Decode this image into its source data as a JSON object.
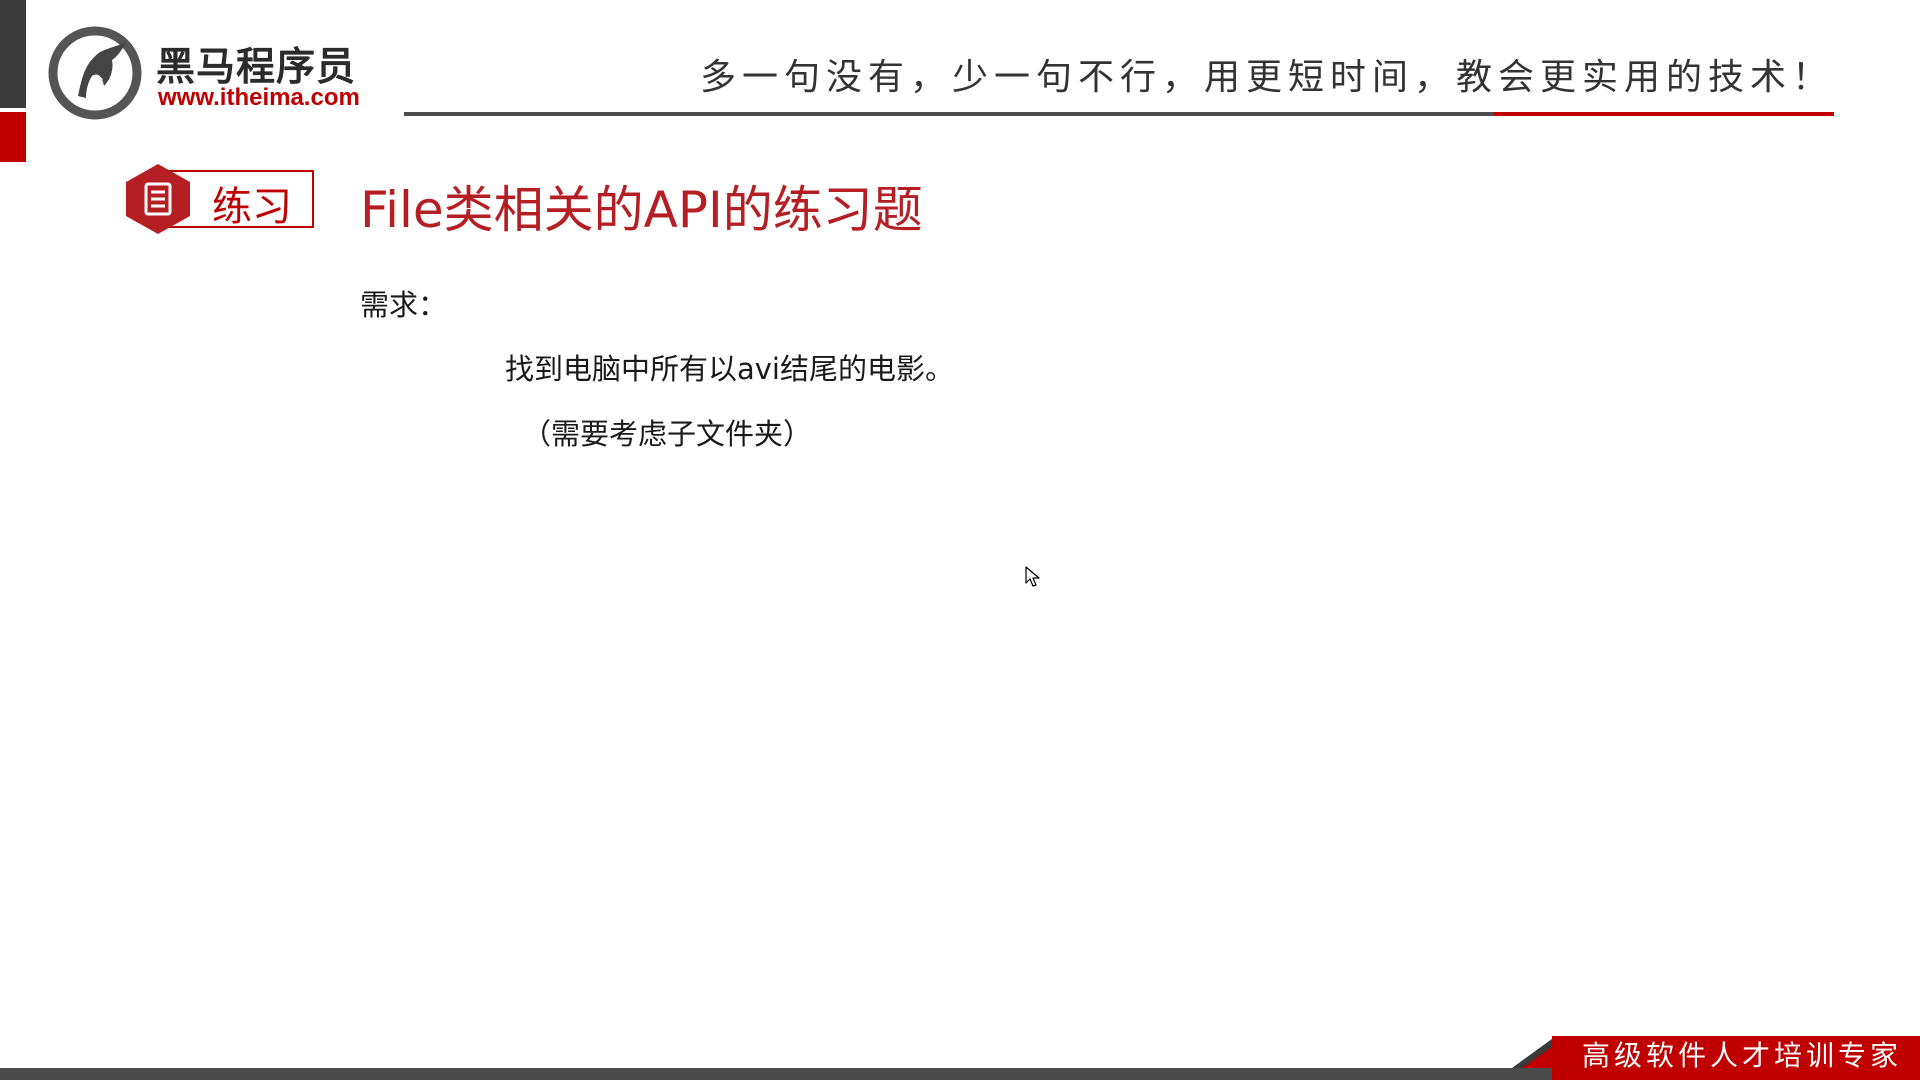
{
  "brand": {
    "name_cn": "黑马程序员",
    "url": "www.itheima.com",
    "accent_color": "#c00000",
    "dark_color": "#3a3a3a"
  },
  "header": {
    "slogan": "多一句没有，少一句不行，用更短时间，教会更实用的技术！"
  },
  "section": {
    "tag_label": "练习",
    "tag_icon": "document-icon",
    "title": "File类相关的API的练习题"
  },
  "content": {
    "requirement_label": "需求：",
    "requirement_line1": "找到电脑中所有以avi结尾的电影。",
    "requirement_line2": "（需要考虑子文件夹）"
  },
  "footer": {
    "tagline": "高级软件人才培训专家"
  },
  "icons": {
    "logo": "horse-logo-icon",
    "cursor": "mouse-pointer-icon"
  }
}
